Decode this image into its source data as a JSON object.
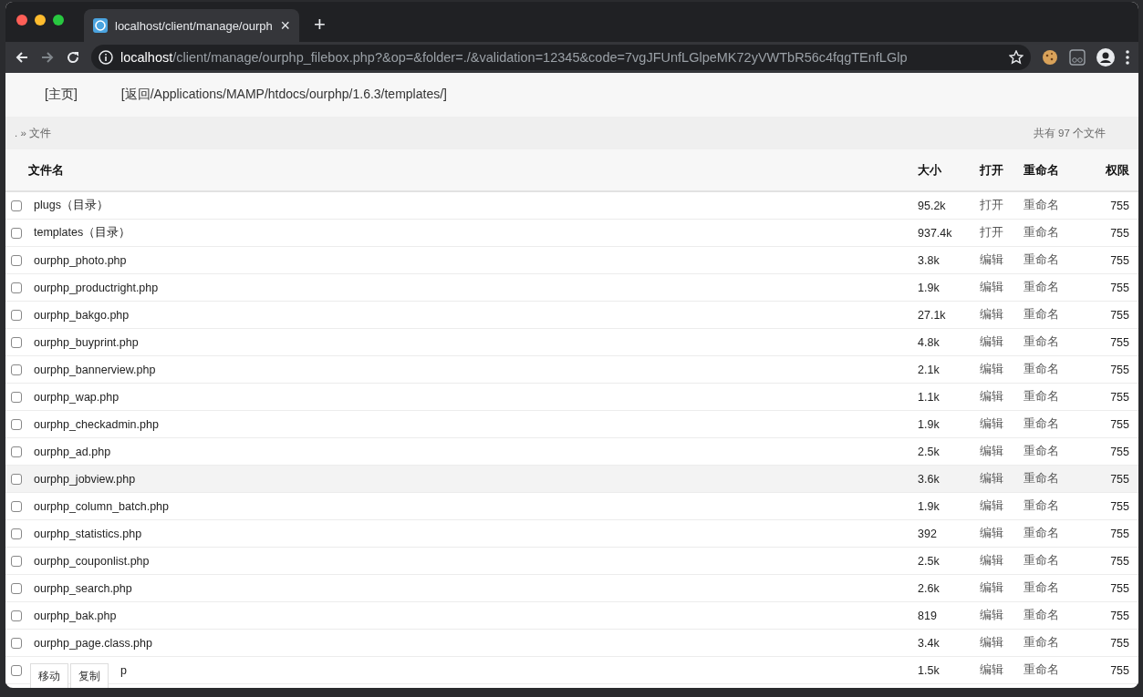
{
  "browser": {
    "tab_title": "localhost/client/manage/ourph",
    "tab_close": "×",
    "new_tab": "+",
    "url_host": "localhost",
    "url_path": "/client/manage/ourphp_filebox.php?&op=&folder=./&validation=12345&code=7vgJFUnfLGlpeMK72yVWTbR56c4fqgTEnfLGlp"
  },
  "nav": {
    "home": "[主页]",
    "back": "[返回/Applications/MAMP/htdocs/ourphp/1.6.3/templates/]"
  },
  "breadcrumb": {
    "path": ". » 文件",
    "count": "共有 97 个文件"
  },
  "table": {
    "columns": [
      "文件名",
      "大小",
      "打开",
      "重命名",
      "权限"
    ],
    "rows": [
      {
        "name": "plugs（目录）",
        "size": "95.2k",
        "open": "打开",
        "rename": "重命名",
        "perm": "755",
        "checked": false,
        "highlighted": false
      },
      {
        "name": "templates（目录）",
        "size": "937.4k",
        "open": "打开",
        "rename": "重命名",
        "perm": "755",
        "checked": false,
        "highlighted": false
      },
      {
        "name": "ourphp_photo.php",
        "size": "3.8k",
        "open": "编辑",
        "rename": "重命名",
        "perm": "755",
        "checked": false,
        "highlighted": false
      },
      {
        "name": "ourphp_productright.php",
        "size": "1.9k",
        "open": "编辑",
        "rename": "重命名",
        "perm": "755",
        "checked": false,
        "highlighted": false
      },
      {
        "name": "ourphp_bakgo.php",
        "size": "27.1k",
        "open": "编辑",
        "rename": "重命名",
        "perm": "755",
        "checked": false,
        "highlighted": false
      },
      {
        "name": "ourphp_buyprint.php",
        "size": "4.8k",
        "open": "编辑",
        "rename": "重命名",
        "perm": "755",
        "checked": false,
        "highlighted": false
      },
      {
        "name": "ourphp_bannerview.php",
        "size": "2.1k",
        "open": "编辑",
        "rename": "重命名",
        "perm": "755",
        "checked": false,
        "highlighted": false
      },
      {
        "name": "ourphp_wap.php",
        "size": "1.1k",
        "open": "编辑",
        "rename": "重命名",
        "perm": "755",
        "checked": false,
        "highlighted": false
      },
      {
        "name": "ourphp_checkadmin.php",
        "size": "1.9k",
        "open": "编辑",
        "rename": "重命名",
        "perm": "755",
        "checked": false,
        "highlighted": false
      },
      {
        "name": "ourphp_ad.php",
        "size": "2.5k",
        "open": "编辑",
        "rename": "重命名",
        "perm": "755",
        "checked": false,
        "highlighted": false
      },
      {
        "name": "ourphp_jobview.php",
        "size": "3.6k",
        "open": "编辑",
        "rename": "重命名",
        "perm": "755",
        "checked": false,
        "highlighted": true
      },
      {
        "name": "ourphp_column_batch.php",
        "size": "1.9k",
        "open": "编辑",
        "rename": "重命名",
        "perm": "755",
        "checked": false,
        "highlighted": false
      },
      {
        "name": "ourphp_statistics.php",
        "size": "392",
        "open": "编辑",
        "rename": "重命名",
        "perm": "755",
        "checked": false,
        "highlighted": false
      },
      {
        "name": "ourphp_couponlist.php",
        "size": "2.5k",
        "open": "编辑",
        "rename": "重命名",
        "perm": "755",
        "checked": false,
        "highlighted": false
      },
      {
        "name": "ourphp_search.php",
        "size": "2.6k",
        "open": "编辑",
        "rename": "重命名",
        "perm": "755",
        "checked": false,
        "highlighted": false
      },
      {
        "name": "ourphp_bak.php",
        "size": "819",
        "open": "编辑",
        "rename": "重命名",
        "perm": "755",
        "checked": false,
        "highlighted": false
      },
      {
        "name": "ourphp_page.class.php",
        "size": "3.4k",
        "open": "编辑",
        "rename": "重命名",
        "perm": "755",
        "checked": false,
        "highlighted": false
      },
      {
        "name": "p",
        "size": "1.5k",
        "open": "编辑",
        "rename": "重命名",
        "perm": "755",
        "checked": false,
        "highlighted": false,
        "covered": true
      }
    ]
  },
  "actions": [
    "移动",
    "复制"
  ]
}
